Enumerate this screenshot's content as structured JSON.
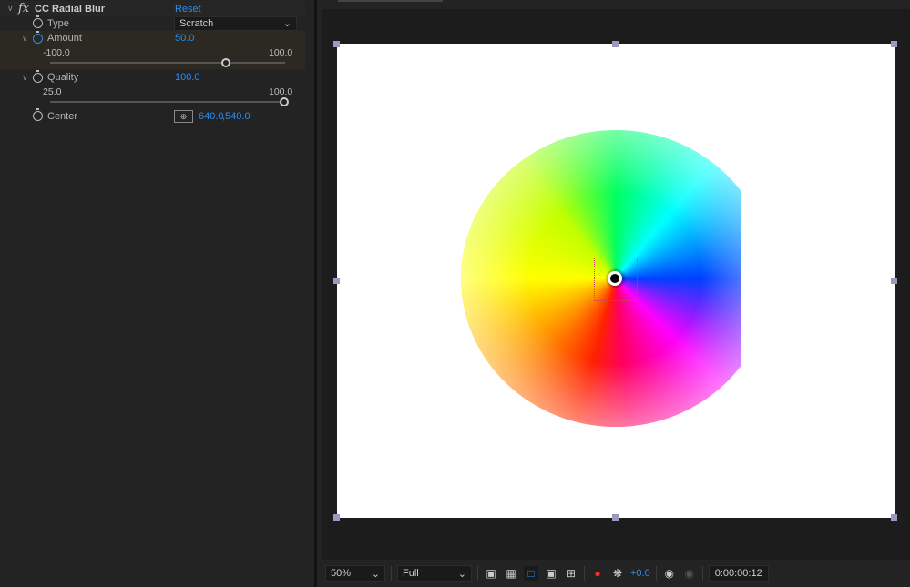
{
  "effect": {
    "name": "CC Radial Blur",
    "fx_icon": "fx",
    "reset": "Reset",
    "type": {
      "label": "Type",
      "value": "Scratch"
    },
    "amount": {
      "label": "Amount",
      "value": "50.0",
      "min": "-100.0",
      "max": "100.0",
      "slider_fraction": 0.75
    },
    "quality": {
      "label": "Quality",
      "value": "100.0",
      "min": "25.0",
      "max": "100.0",
      "slider_fraction": 1.0
    },
    "center": {
      "label": "Center",
      "x": "640.0",
      "y": ",540.0"
    }
  },
  "viewer": {
    "zoom": "50%",
    "resolution": "Full",
    "exposure": "+0.0",
    "timecode": "0:00:00:12",
    "accent": "#2d8ceb"
  }
}
